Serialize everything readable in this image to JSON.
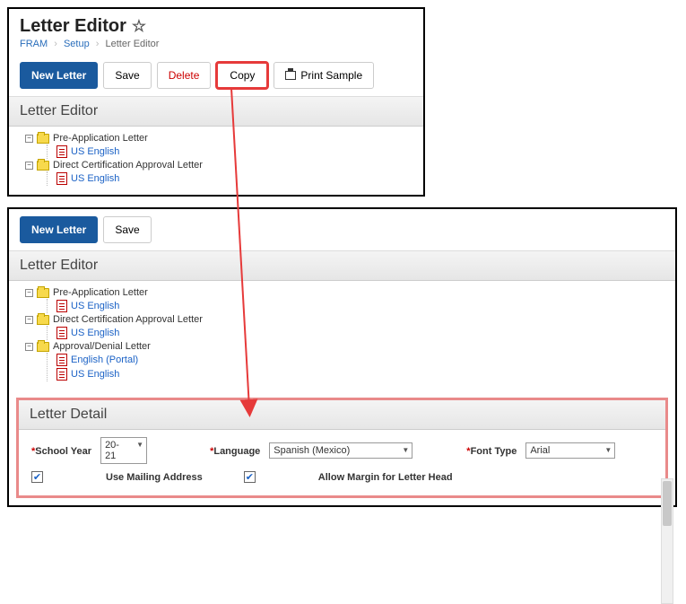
{
  "top": {
    "page_title": "Letter Editor",
    "breadcrumb": {
      "a": "FRAM",
      "b": "Setup",
      "c": "Letter Editor"
    },
    "toolbar": {
      "new_letter": "New Letter",
      "save": "Save",
      "delete": "Delete",
      "copy": "Copy",
      "print_sample": "Print Sample"
    },
    "section": "Letter Editor",
    "tree": [
      {
        "label": "Pre-Application Letter",
        "children": [
          {
            "label": "US English"
          }
        ]
      },
      {
        "label": "Direct Certification Approval Letter",
        "children": [
          {
            "label": "US English"
          }
        ]
      }
    ]
  },
  "bottom": {
    "toolbar": {
      "new_letter": "New Letter",
      "save": "Save"
    },
    "section": "Letter Editor",
    "tree": [
      {
        "label": "Pre-Application Letter",
        "children": [
          {
            "label": "US English"
          }
        ]
      },
      {
        "label": "Direct Certification Approval Letter",
        "children": [
          {
            "label": "US English"
          }
        ]
      },
      {
        "label": "Approval/Denial Letter",
        "children": [
          {
            "label": "English (Portal)"
          },
          {
            "label": "US English"
          }
        ]
      }
    ],
    "detail": {
      "title": "Letter Detail",
      "school_year_label": "School Year",
      "school_year_value": "20-21",
      "language_label": "Language",
      "language_value": "Spanish (Mexico)",
      "font_type_label": "Font Type",
      "font_type_value": "Arial",
      "use_mailing": "Use Mailing Address",
      "allow_margin": "Allow Margin for Letter Head"
    }
  }
}
